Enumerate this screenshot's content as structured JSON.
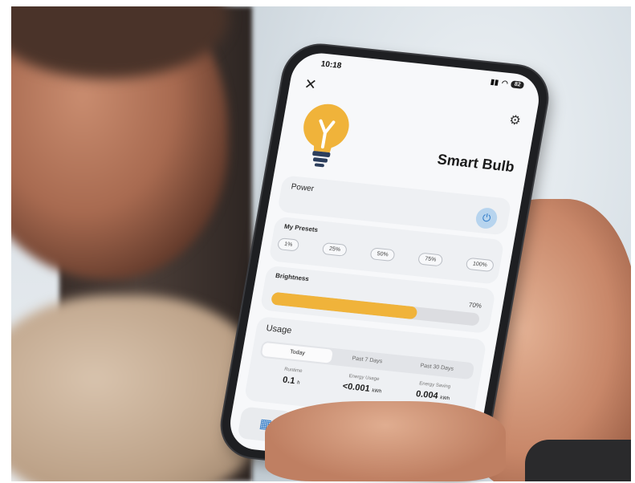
{
  "status": {
    "time": "10:18",
    "battery": "82"
  },
  "app": {
    "title": "Smart Bulb"
  },
  "power": {
    "label": "Power"
  },
  "presets": {
    "label": "My Presets",
    "items": [
      "1%",
      "25%",
      "50%",
      "75%",
      "100%"
    ]
  },
  "brightness": {
    "label": "Brightness",
    "value_text": "70%",
    "value": 0.7
  },
  "usage": {
    "label": "Usage",
    "tabs": [
      "Today",
      "Past 7 Days",
      "Past 30 Days"
    ],
    "active_tab": "Today",
    "stats": [
      {
        "label": "Runtime",
        "value": "0.1",
        "unit": "h"
      },
      {
        "label": "Energy Usage",
        "value": "<0.001",
        "unit": "kWh"
      },
      {
        "label": "Energy Saving",
        "value": "0.004",
        "unit": "kWh"
      }
    ]
  },
  "nav": {
    "items": [
      "calendar-icon",
      "timer-icon",
      "vacation-icon"
    ]
  },
  "colors": {
    "accent": "#f0b33a",
    "power_button": "#b7d4ee",
    "screen_bg": "#f7f8fa"
  }
}
